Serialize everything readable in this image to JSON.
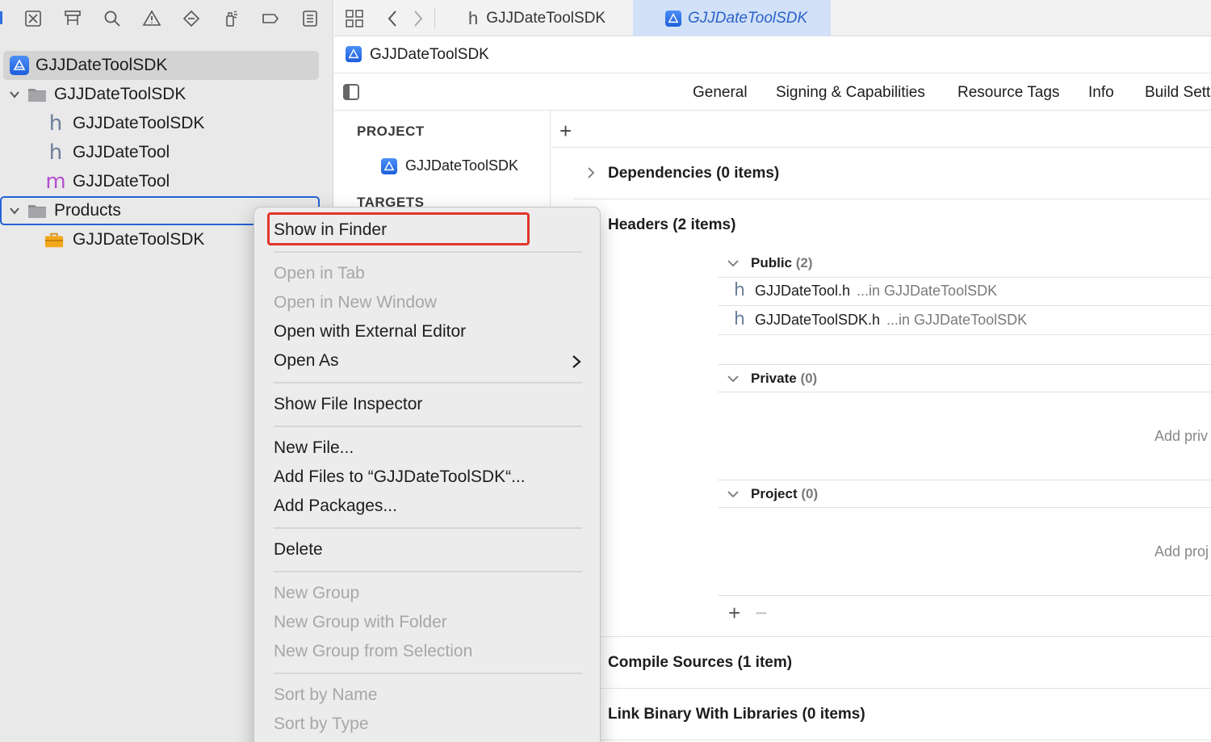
{
  "navigator": {
    "toolbar_icons": [
      "folder-icon",
      "source-control-icon",
      "symbol-hierarchy-icon",
      "find-icon",
      "issue-warning-icon",
      "test-diamond-icon",
      "debug-spray-icon",
      "breakpoint-icon",
      "report-icon"
    ],
    "tree": {
      "project": "GJJDateToolSDK",
      "group": "GJJDateToolSDK",
      "files": [
        {
          "type": "h",
          "name": "GJJDateToolSDK"
        },
        {
          "type": "h",
          "name": "GJJDateTool"
        },
        {
          "type": "m",
          "name": "GJJDateTool"
        }
      ],
      "products_group": "Products",
      "product": "GJJDateToolSDK"
    }
  },
  "tabbar": {
    "tab_header": "GJJDateToolSDK",
    "tab_active": "GJJDateToolSDK",
    "type_letter": "h"
  },
  "jumpbar": {
    "crumb": "GJJDateToolSDK"
  },
  "editor_tabs": [
    "General",
    "Signing & Capabilities",
    "Resource Tags",
    "Info",
    "Build Sett"
  ],
  "targets": {
    "project_heading": "PROJECT",
    "project_item": "GJJDateToolSDK",
    "targets_heading": "TARGETS"
  },
  "phases": {
    "dependencies": "Dependencies (0 items)",
    "headers": "Headers (2 items)",
    "public_label": "Public",
    "public_count": "(2)",
    "public_files": [
      {
        "name": "GJJDateTool.h",
        "location": "...in GJJDateToolSDK"
      },
      {
        "name": "GJJDateToolSDK.h",
        "location": "...in GJJDateToolSDK"
      }
    ],
    "private_label": "Private",
    "private_count": "(0)",
    "private_hint": "Add priv",
    "project_label": "Project",
    "project_count": "(0)",
    "project_hint": "Add proj",
    "compile_sources": "Compile Sources (1 item)",
    "link_binary": "Link Binary With Libraries (0 items)"
  },
  "context_menu": {
    "show_in_finder": "Show in Finder",
    "open_in_tab": "Open in Tab",
    "open_in_new_window": "Open in New Window",
    "open_with_external_editor": "Open with External Editor",
    "open_as": "Open As",
    "show_file_inspector": "Show File Inspector",
    "new_file": "New File...",
    "add_files": "Add Files to “GJJDateToolSDK“...",
    "add_packages": "Add Packages...",
    "delete": "Delete",
    "new_group": "New Group",
    "new_group_with_folder": "New Group with Folder",
    "new_group_from_selection": "New Group from Selection",
    "sort_by_name": "Sort by Name",
    "sort_by_type": "Sort by Type"
  },
  "colors": {
    "accent_blue": "#2463d6",
    "highlight_red": "#e0362c",
    "selected_tab_bg": "#d2e1f8"
  }
}
